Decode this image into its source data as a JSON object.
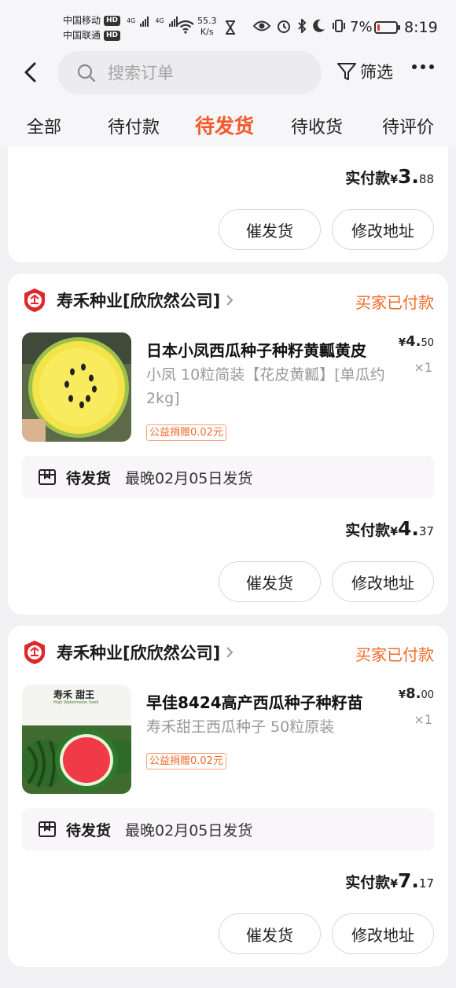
{
  "status_bar": {
    "carrier1": "中国移动",
    "carrier2": "中国联通",
    "hd": "HD",
    "net_tag": "4G",
    "speed_value": "55.3",
    "speed_unit": "K/s",
    "battery": "7%",
    "time": "8:19"
  },
  "header": {
    "search_placeholder": "搜索订单",
    "filter_label": "筛选"
  },
  "tabs": [
    "全部",
    "待付款",
    "待发货",
    "待收货",
    "待评价"
  ],
  "active_tab": 2,
  "top_card": {
    "paid_label": "实付款",
    "currency": "¥",
    "paid_int": "3.",
    "paid_dec": "88",
    "urge_label": "催发货",
    "address_label": "修改地址"
  },
  "orders": [
    {
      "shop_name": "寿禾种业[欣欣然公司]",
      "status": "买家已付款",
      "title": "日本小凤西瓜种子种籽黄瓤黄皮",
      "spec": "小凤 10粒简装【花皮黄瓤】[单瓜约2kg]",
      "price_int": "4.",
      "price_dec": "50",
      "qty": "×1",
      "charity": "公益捐赠0.02元",
      "ship_label": "待发货",
      "ship_deadline": "最晚02月05日发货",
      "paid_label": "实付款",
      "paid_int": "4.",
      "paid_dec": "37",
      "urge_label": "催发货",
      "address_label": "修改地址"
    },
    {
      "shop_name": "寿禾种业[欣欣然公司]",
      "status": "买家已付款",
      "title": "早佳8424高产西瓜种子种籽苗",
      "spec": "寿禾甜王西瓜种子 50粒原装",
      "package_text": "寿禾 甜王",
      "package_subtitle": "High Watermelon Seed",
      "price_int": "8.",
      "price_dec": "00",
      "qty": "×1",
      "charity": "公益捐赠0.02元",
      "ship_label": "待发货",
      "ship_deadline": "最晚02月05日发货",
      "paid_label": "实付款",
      "paid_int": "7.",
      "paid_dec": "17",
      "urge_label": "催发货",
      "address_label": "修改地址"
    }
  ],
  "colors": {
    "accent": "#f5582a",
    "status_orange": "#f06a2a",
    "shop_red": "#e0262a"
  },
  "icons": [
    "back-arrow-icon",
    "search-icon",
    "filter-icon",
    "more-icon",
    "shop-logo-icon",
    "chevron-right-icon",
    "shipping-box-icon"
  ]
}
